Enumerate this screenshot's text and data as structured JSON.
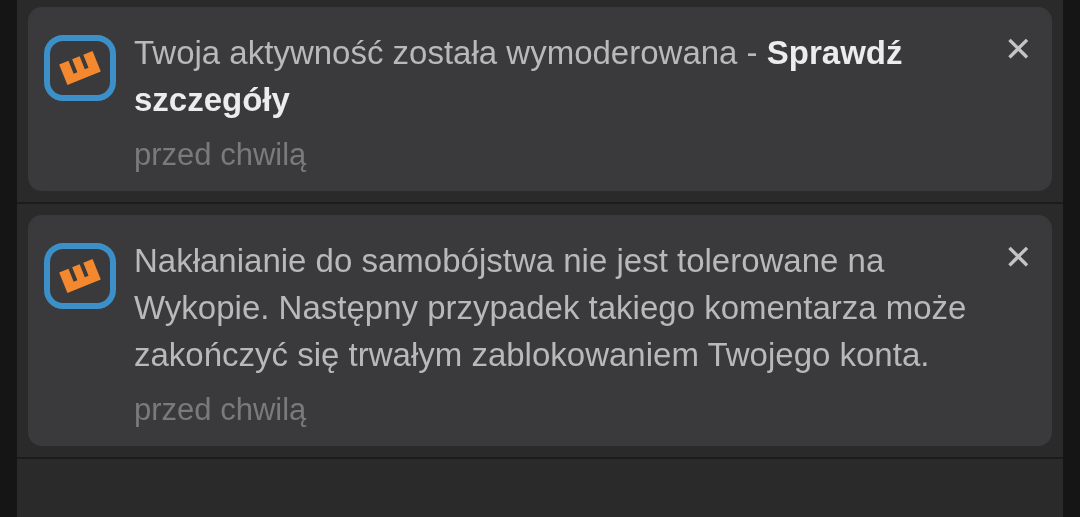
{
  "notifications": [
    {
      "message": "Twoja aktywność została wymoderowana - **Sprawdź szczegóły**",
      "time": "przed chwilą",
      "close": "✕"
    },
    {
      "message": "Nakłanianie do samobójstwa nie jest tolerowane na Wykopie. Następny przypadek takiego komentarza może zakończyć się trwałym zablokowaniem Twojego konta.",
      "time": "przed chwilą",
      "close": "✕"
    }
  ]
}
